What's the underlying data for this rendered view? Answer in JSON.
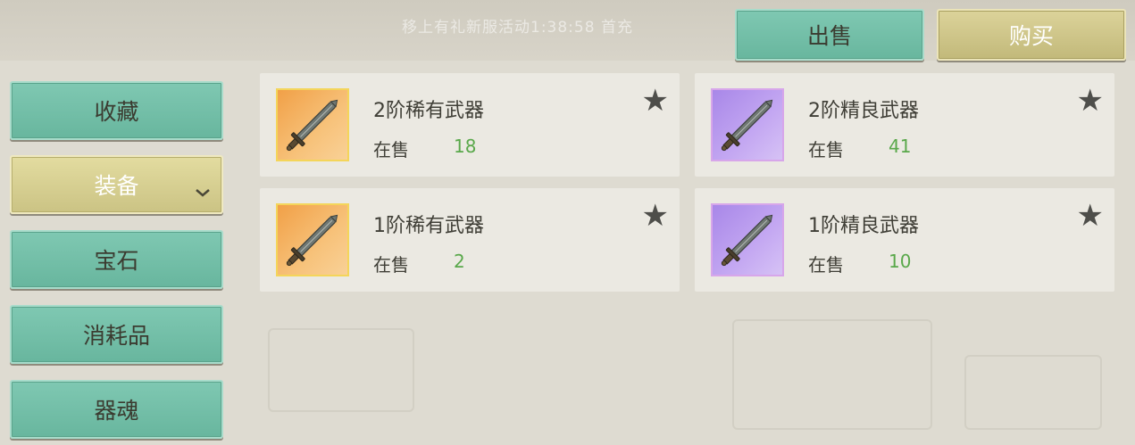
{
  "top_bar": {
    "banner_text": "移上有礼新服活动1:38:58  首充",
    "sell_label": "出售",
    "buy_label": "购买"
  },
  "sidebar": {
    "items": [
      {
        "label": "收藏",
        "active": false
      },
      {
        "label": "装备",
        "active": true,
        "has_dropdown": true
      },
      {
        "label": "宝石",
        "active": false
      },
      {
        "label": "消耗品",
        "active": false
      },
      {
        "label": "器魂",
        "active": false
      }
    ]
  },
  "items": [
    {
      "name": "2阶稀有武器",
      "sale_label": "在售",
      "count": "18",
      "rarity": "rare",
      "icon": "sword-icon"
    },
    {
      "name": "2阶精良武器",
      "sale_label": "在售",
      "count": "41",
      "rarity": "epic",
      "icon": "sword-icon"
    },
    {
      "name": "1阶稀有武器",
      "sale_label": "在售",
      "count": "2",
      "rarity": "rare",
      "icon": "sword-icon"
    },
    {
      "name": "1阶精良武器",
      "sale_label": "在售",
      "count": "10",
      "rarity": "epic",
      "icon": "sword-icon"
    }
  ],
  "colors": {
    "teal_button": "#7fc8b2",
    "gold_button": "#e3dca0",
    "rare_frame": "#f1a047",
    "epic_frame": "#a887e8",
    "count_green": "#59a84a"
  }
}
